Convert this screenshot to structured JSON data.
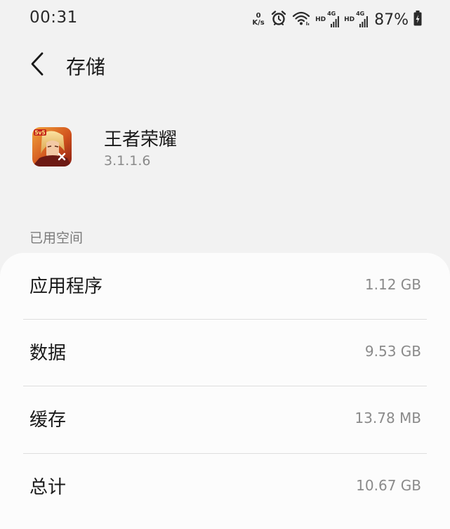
{
  "status_bar": {
    "time": "00:31",
    "net_speed_value": "0",
    "net_speed_unit": "K/s",
    "sim1_hd": "HD",
    "sim1_network": "4G",
    "sim2_hd": "HD",
    "sim2_network": "4G",
    "battery": "87%",
    "icons": [
      "alarm-icon",
      "wifi-icon",
      "signal-icon",
      "battery-charging-icon"
    ]
  },
  "header": {
    "back_icon": "chevron-left-icon",
    "title": "存储"
  },
  "app": {
    "icon": "app-icon-honor-of-kings",
    "name": "王者荣耀",
    "version": "3.1.1.6"
  },
  "section": {
    "label": "已用空间"
  },
  "storage": {
    "rows": [
      {
        "label": "应用程序",
        "value": "1.12 GB"
      },
      {
        "label": "数据",
        "value": "9.53 GB"
      },
      {
        "label": "缓存",
        "value": "13.78 MB"
      },
      {
        "label": "总计",
        "value": "10.67 GB"
      }
    ]
  },
  "colors": {
    "background": "#f2f2f2",
    "card": "#fcfcfc",
    "secondary_text": "#8a8a8a",
    "divider": "#dedede"
  }
}
